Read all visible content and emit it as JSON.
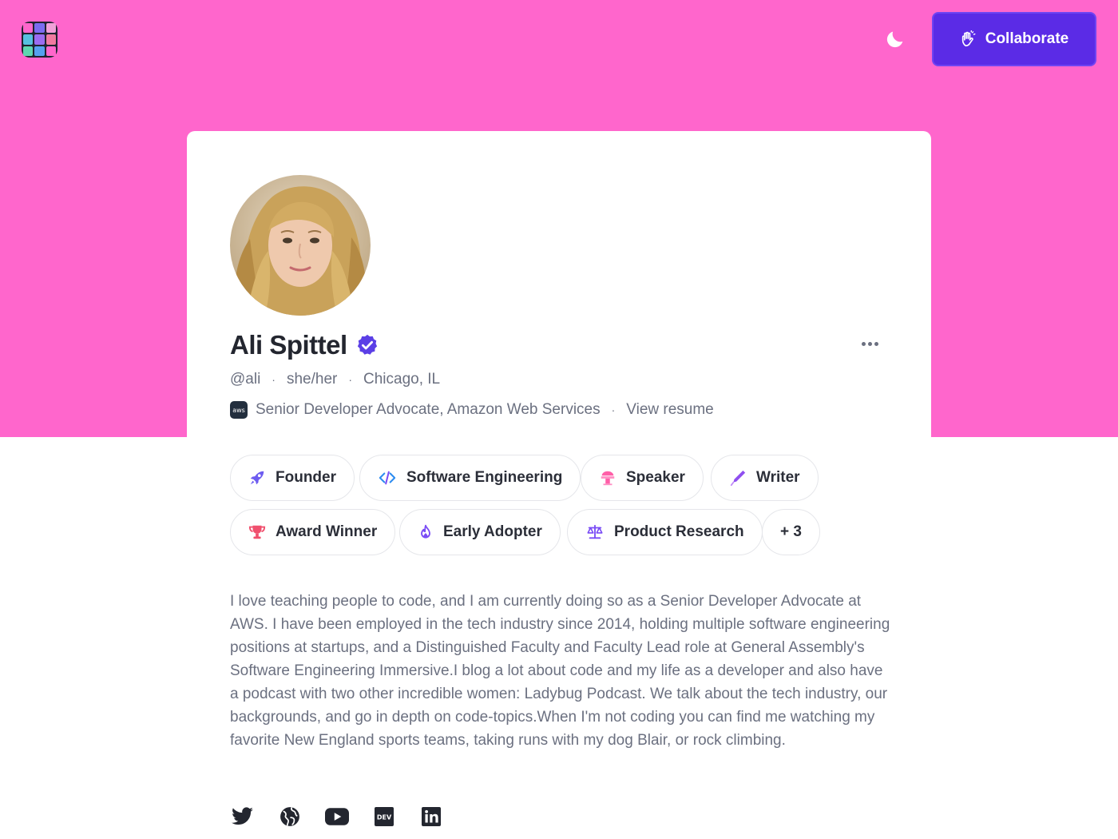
{
  "header": {
    "logo_name": "app-logo",
    "collaborate_label": "Collaborate",
    "colors": {
      "hero": "#ff66cc",
      "button": "#5b2be6"
    }
  },
  "profile": {
    "name": "Ali Spittel",
    "handle": "@ali",
    "pronouns": "she/her",
    "location": "Chicago, IL",
    "job_title": "Senior Developer Advocate, Amazon Web Services",
    "company_logo_text": "aws",
    "view_resume": "View resume"
  },
  "tags": [
    {
      "label": "Founder",
      "icon": "rocket-icon",
      "color": "#6d5cf0"
    },
    {
      "label": "Software Engineering",
      "icon": "code-icon",
      "color": "#2d8cf0"
    },
    {
      "label": "Speaker",
      "icon": "podium-icon",
      "color": "#ff5fa8"
    },
    {
      "label": "Writer",
      "icon": "pen-icon",
      "color": "#8f4ff0"
    },
    {
      "label": "Award Winner",
      "icon": "trophy-icon",
      "color": "#f0506e"
    },
    {
      "label": "Early Adopter",
      "icon": "flame-icon",
      "color": "#7a4cf5"
    },
    {
      "label": "Product Research",
      "icon": "scale-icon",
      "color": "#7a4cf5"
    },
    {
      "label": "+ 3",
      "icon": "",
      "color": ""
    }
  ],
  "bio": "I love teaching people to code, and I am currently doing so as a Senior Developer Advocate at AWS. I have been employed in the tech industry since 2014, holding multiple software engineering positions at startups, and a Distinguished Faculty and Faculty Lead role at General Assembly's Software Engineering Immersive.I blog a lot about code and my life as a developer and also have a podcast with two other incredible women: Ladybug Podcast. We talk about the tech industry, our backgrounds, and go in depth on code-topics.When I'm not coding you can find me watching my favorite New England sports teams, taking runs with my dog Blair, or rock climbing.",
  "social": [
    "twitter-icon",
    "globe-icon",
    "youtube-icon",
    "dev-icon",
    "linkedin-icon"
  ],
  "dev_icon_text": "DEV"
}
